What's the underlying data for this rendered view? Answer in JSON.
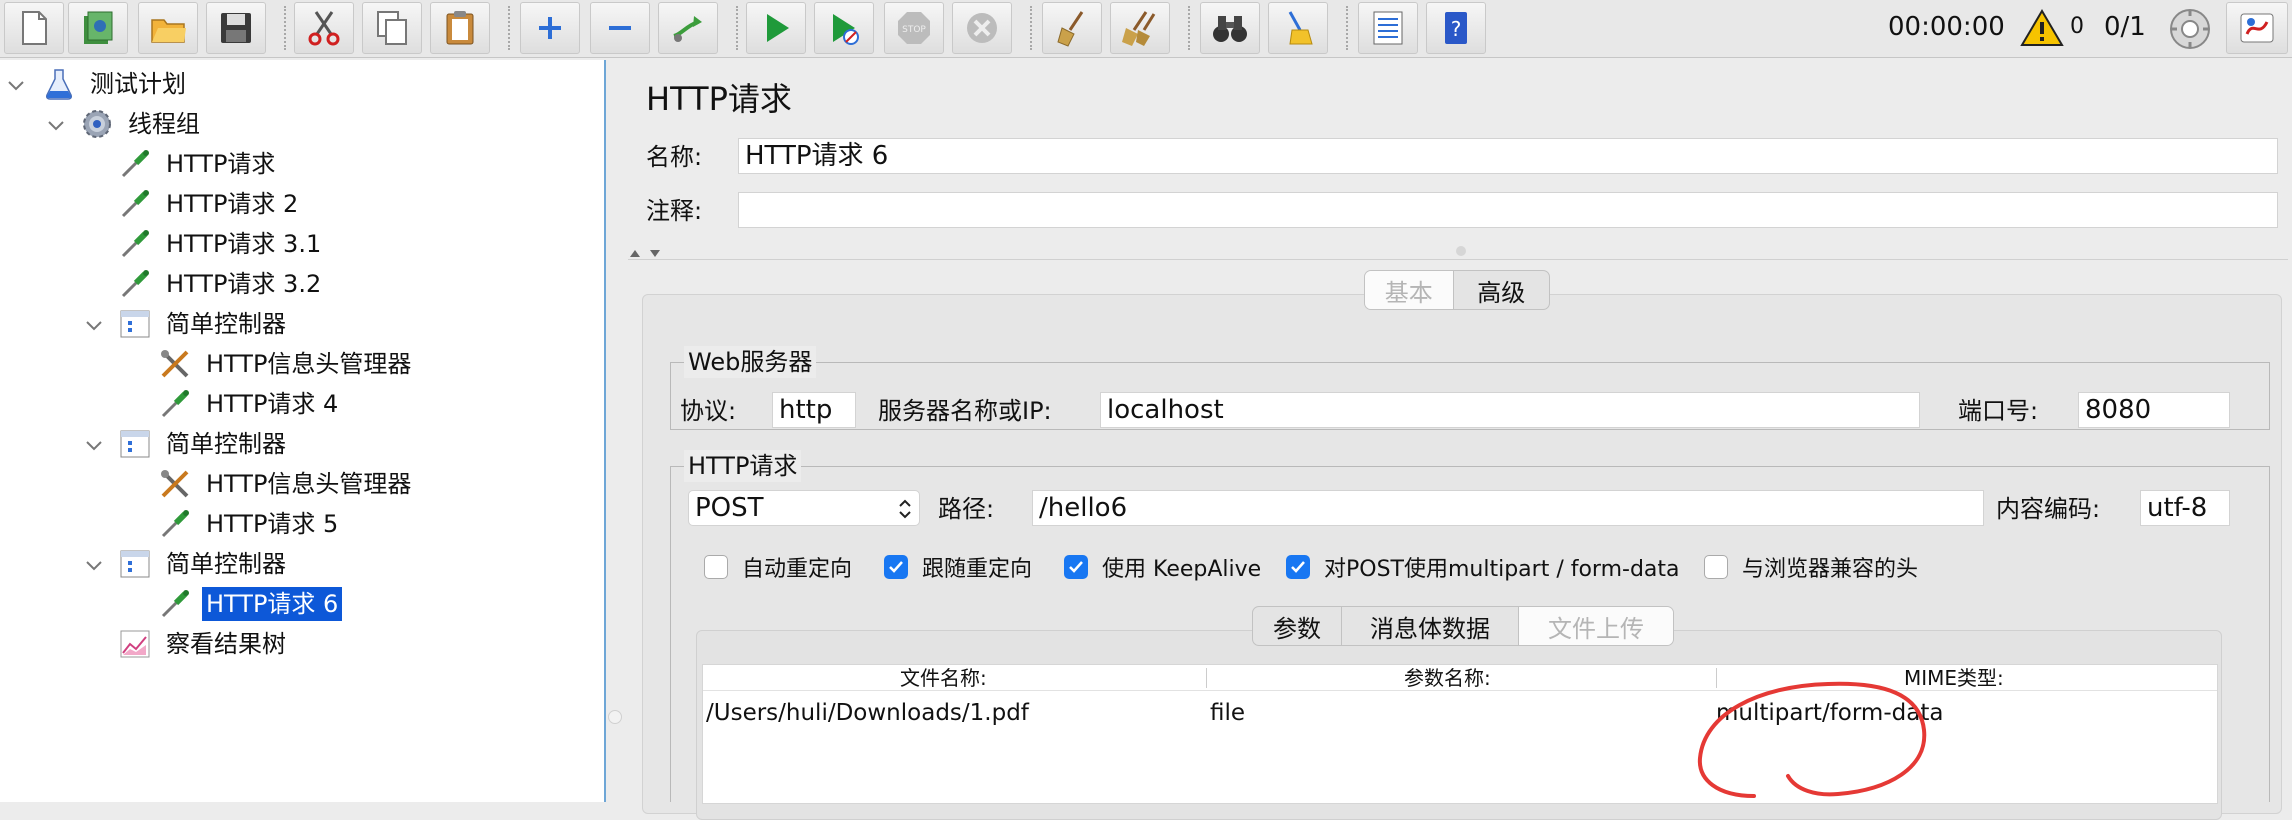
{
  "toolbar": {
    "elapsed_time": "00:00:00",
    "warning_count": "0",
    "thread_ratio": "0/1"
  },
  "tree": {
    "items": [
      {
        "label": "测试计划"
      },
      {
        "label": "线程组"
      },
      {
        "label": "HTTP请求"
      },
      {
        "label": "HTTP请求 2"
      },
      {
        "label": "HTTP请求 3.1"
      },
      {
        "label": "HTTP请求 3.2"
      },
      {
        "label": "简单控制器"
      },
      {
        "label": "HTTP信息头管理器"
      },
      {
        "label": "HTTP请求 4"
      },
      {
        "label": "简单控制器"
      },
      {
        "label": "HTTP信息头管理器"
      },
      {
        "label": "HTTP请求 5"
      },
      {
        "label": "简单控制器"
      },
      {
        "label": "HTTP请求 6"
      },
      {
        "label": "察看结果树"
      }
    ]
  },
  "panel": {
    "title": "HTTP请求",
    "name_label": "名称:",
    "name_value": "HTTP请求 6",
    "comment_label": "注释:",
    "comment_value": "",
    "tabs": {
      "basic": "基本",
      "advanced": "高级"
    },
    "web_server": {
      "title": "Web服务器",
      "protocol_label": "协议:",
      "protocol_value": "http",
      "server_label": "服务器名称或IP:",
      "server_value": "localhost",
      "port_label": "端口号:",
      "port_value": "8080"
    },
    "http_request": {
      "title": "HTTP请求",
      "method": "POST",
      "path_label": "路径:",
      "path_value": "/hello6",
      "encoding_label": "内容编码:",
      "encoding_value": "utf-8",
      "options": [
        {
          "label": "自动重定向",
          "checked": false
        },
        {
          "label": "跟随重定向",
          "checked": true
        },
        {
          "label": "使用 KeepAlive",
          "checked": true
        },
        {
          "label": "对POST使用multipart / form-data",
          "checked": true
        },
        {
          "label": "与浏览器兼容的头",
          "checked": false
        }
      ]
    },
    "sub_tabs": {
      "params": "参数",
      "body": "消息体数据",
      "files": "文件上传"
    },
    "files_table": {
      "headers": [
        "文件名称:",
        "参数名称:",
        "MIME类型:"
      ],
      "rows": [
        {
          "file": "/Users/huli/Downloads/1.pdf",
          "param": "file",
          "mime": "multipart/form-data"
        }
      ]
    }
  },
  "colors": {
    "selection": "#0d58d8",
    "checkbox_on": "#1877f2",
    "annotation": "#e53935",
    "tree_border": "#6ea6d6"
  }
}
